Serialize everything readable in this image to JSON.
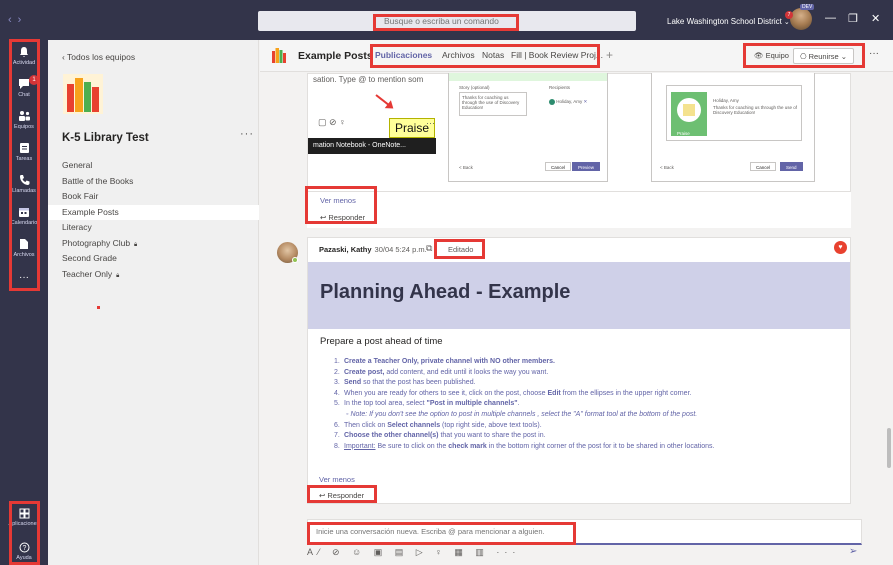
{
  "app": {
    "nav_back": "‹",
    "nav_forward": "›",
    "search_placeholder": "Busque o escriba un comando",
    "org_name": "Lake Washington School District",
    "avatar_badge": "DEV",
    "notif_count": "7",
    "win_minimize": "—",
    "win_maximize": "❐",
    "win_close": "✕"
  },
  "rail": {
    "items": [
      {
        "label": "Actividad",
        "icon": "bell-icon"
      },
      {
        "label": "Chat",
        "icon": "chat-icon",
        "badge": "1"
      },
      {
        "label": "Equipos",
        "icon": "teams-icon"
      },
      {
        "label": "Tareas",
        "icon": "assignments-icon"
      },
      {
        "label": "Llamadas",
        "icon": "phone-icon"
      },
      {
        "label": "Calendario",
        "icon": "calendar-icon"
      },
      {
        "label": "Archivos",
        "icon": "files-icon"
      }
    ],
    "more": "···",
    "apps_label": "Aplicaciones",
    "help_label": "Ayuda"
  },
  "teams_pane": {
    "back_label": "Todos los equipos",
    "team_name": "K-5 Library Test",
    "more": "···",
    "channels": [
      {
        "name": "General",
        "locked": false
      },
      {
        "name": "Battle of the Books",
        "locked": false
      },
      {
        "name": "Book Fair",
        "locked": false
      },
      {
        "name": "Example Posts",
        "locked": false,
        "active": true
      },
      {
        "name": "Literacy",
        "locked": false
      },
      {
        "name": "Photography Club",
        "locked": true
      },
      {
        "name": "Second Grade",
        "locked": false
      },
      {
        "name": "Teacher Only",
        "locked": true
      }
    ]
  },
  "header": {
    "channel_title": "Example Posts",
    "tabs": [
      "Publicaciones",
      "Archivos",
      "Notas",
      "Fill | Book Review Proj..."
    ],
    "add_tab": "+",
    "team_btn": "Equipo",
    "meet_btn": "Reunirse",
    "more": "···"
  },
  "post1": {
    "mention_text": "sation. Type @ to mention som",
    "praise_label": "Praise",
    "dark_strip": "mation Notebook - OneNote...",
    "shot_texts": [
      "Story (optional)",
      "Thanks for coaching us through the use of Discovery Education!",
      "Recipients",
      "Holiday, Amy",
      "Praise",
      "Holiday, Amy",
      "Thanks for coaching us through the use of Discovery Education!",
      "< Back",
      "Cancel",
      "Preview",
      "< Back",
      "Cancel",
      "Send"
    ],
    "ver_menos": "Ver menos",
    "reply": "Responder"
  },
  "post2": {
    "author": "Pazaski, Kathy",
    "time": "30/04 5:24 p.m.",
    "edited": "Editado",
    "banner_title": "Planning Ahead - Example",
    "subtitle": "Prepare a post ahead of time",
    "steps": [
      {
        "n": "1.",
        "bold": "Create a Teacher Only, private channel with NO other members.",
        "rest": ""
      },
      {
        "n": "2.",
        "bold": "Create post,",
        "rest": " add content, and edit until it looks the way you want."
      },
      {
        "n": "3.",
        "bold": "Send",
        "rest": " so that the post has been published."
      },
      {
        "n": "4.",
        "bold": "",
        "rest": "When you are ready for others to see it, click on the post, choose ",
        "bold2": "Edit",
        "rest2": " from the ellipses in the upper right corner."
      },
      {
        "n": "5.",
        "bold": "",
        "rest": "In the top tool area, select ",
        "bold2": "\"Post in multiple channels\"",
        "rest2": "."
      },
      {
        "n": "6.",
        "bold": "",
        "rest": "Then click on ",
        "bold2": "Select channels",
        "rest2": " (top right side, above text tools)."
      },
      {
        "n": "7.",
        "bold": "Choose the other channel(s)",
        "rest": " that you want to share the post in."
      },
      {
        "n": "8.",
        "u": "Important:",
        "rest": " Be sure to click on the ",
        "bold2": "check mark",
        "rest2": " in the bottom right corner of the post for it to be shared in other locations."
      }
    ],
    "note": "Note: If you don't see the option to post in multiple channels , select the \"A\" format tool at the bottom of the post.",
    "ver_menos": "Ver menos",
    "reply": "Responder"
  },
  "compose": {
    "placeholder": "Inicie una conversación nueva. Escriba @ para mencionar a alguien.",
    "send": "➢"
  },
  "colors": {
    "rail_bg": "#33344a",
    "accent": "#6264a7",
    "highlight_box": "#e53935",
    "banner_bg": "#cfd0e8"
  }
}
